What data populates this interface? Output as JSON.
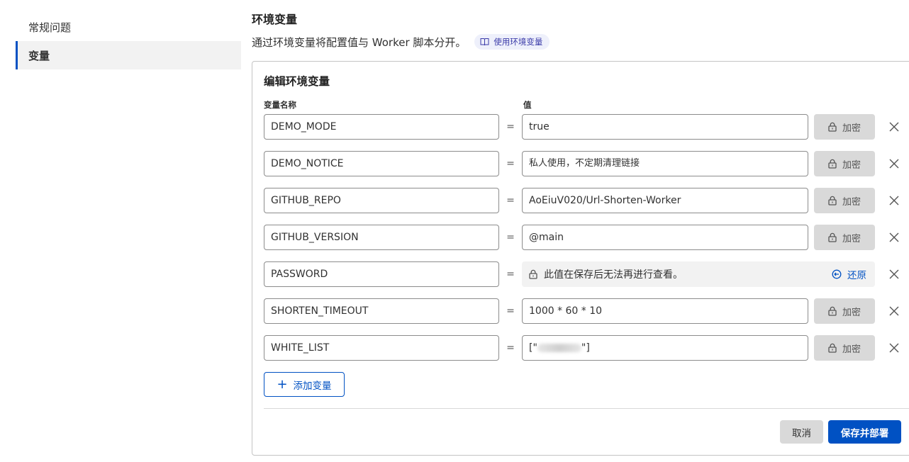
{
  "sidebar": {
    "items": [
      {
        "label": "常规问题"
      },
      {
        "label": "变量"
      }
    ]
  },
  "header": {
    "title": "环境变量",
    "description": "通过环境变量将配置值与 Worker 脚本分开。",
    "doc_link_label": "使用环境变量"
  },
  "editor": {
    "title": "编辑环境变量",
    "name_column_label": "变量名称",
    "value_column_label": "值",
    "equals": "=",
    "encrypt_label": "加密",
    "secret_notice": "此值在保存后无法再进行查看。",
    "restore_label": "还原",
    "variables": [
      {
        "name": "DEMO_MODE",
        "value": "true"
      },
      {
        "name": "DEMO_NOTICE",
        "value": "私人使用，不定期清理链接"
      },
      {
        "name": "GITHUB_REPO",
        "value": "AoEiuV020/Url-Shorten-Worker"
      },
      {
        "name": "GITHUB_VERSION",
        "value": "@main"
      },
      {
        "name": "PASSWORD",
        "value": ""
      },
      {
        "name": "SHORTEN_TIMEOUT",
        "value": "1000 * 60 * 10"
      },
      {
        "name": "WHITE_LIST",
        "value_prefix": "[\"",
        "value_suffix": "\"]"
      }
    ],
    "add_label": "添加变量"
  },
  "footer": {
    "cancel_label": "取消",
    "save_label": "保存并部署"
  },
  "colors": {
    "accent": "#0051c3",
    "encrypt_bg": "#d9d9d9",
    "secret_bg": "#f2f2f2"
  }
}
